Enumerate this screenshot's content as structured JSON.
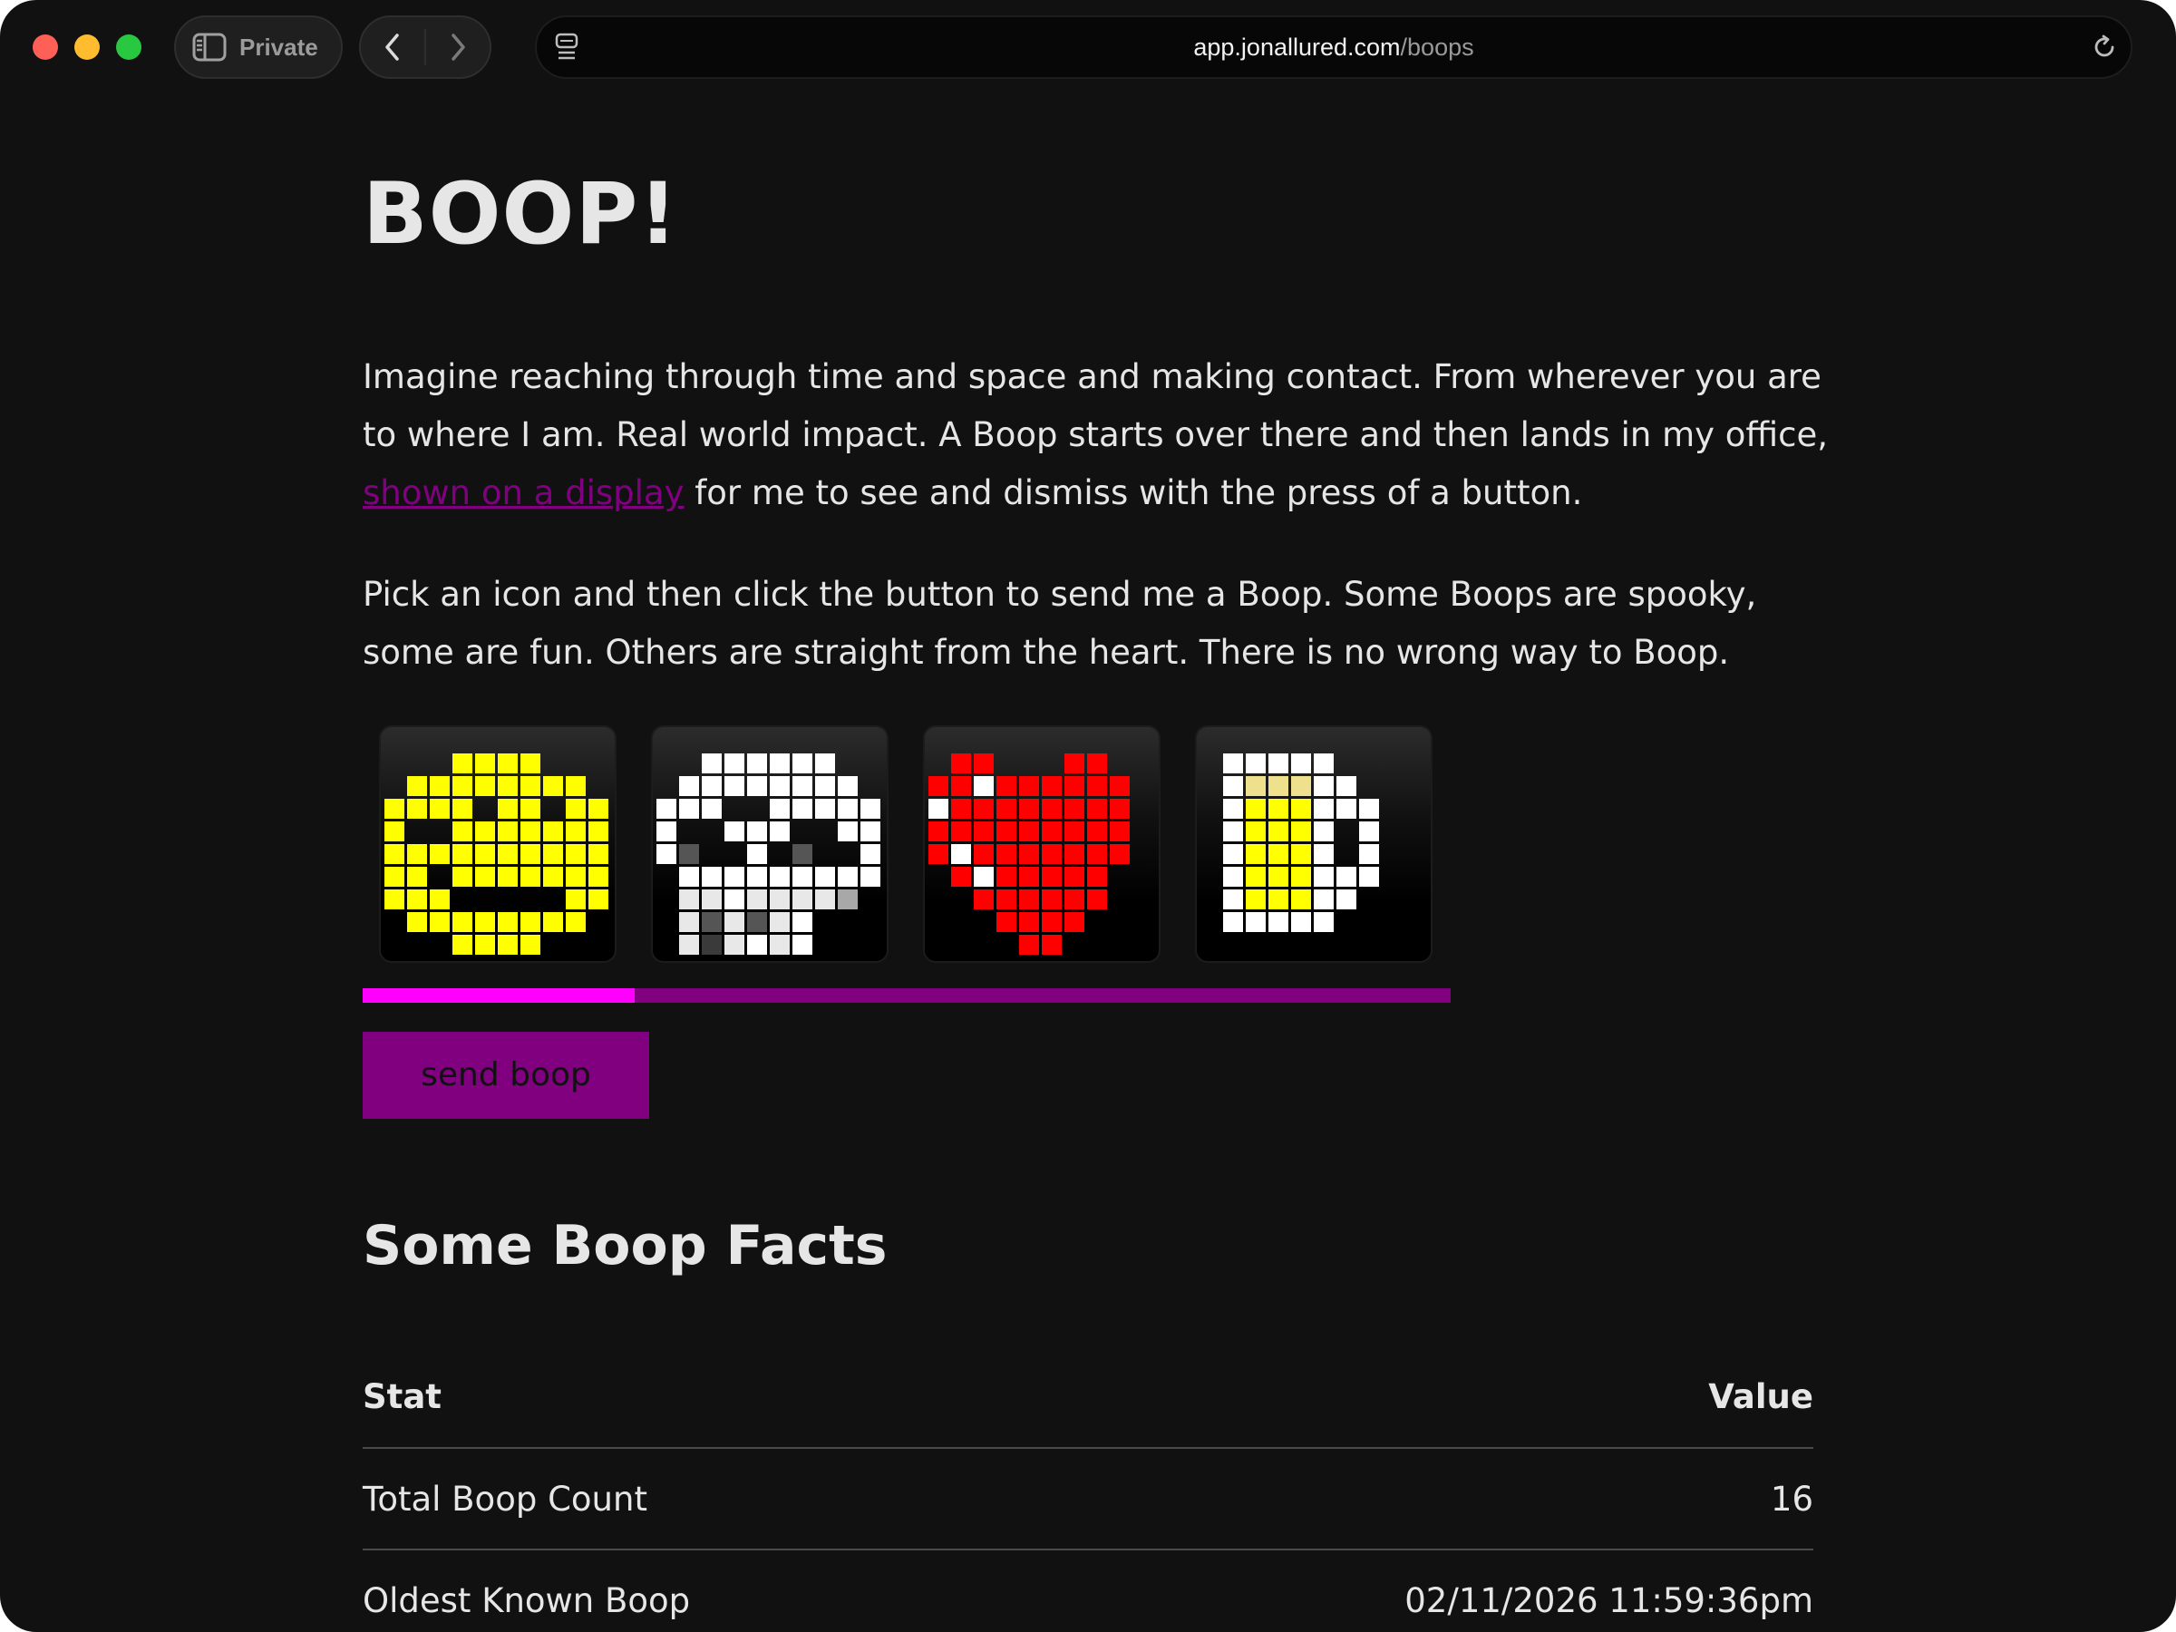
{
  "browser": {
    "private_label": "Private",
    "url_host": "app.jonallured.com",
    "url_path": "/boops"
  },
  "page": {
    "title": "BOOP!",
    "intro_before_link": "Imagine reaching through time and space and making contact. From wherever you are to where I am. Real world impact. A Boop starts over there and then lands in my office, ",
    "intro_link": "shown on a display",
    "intro_after_link": " for me to see and dismiss with the press of a button.",
    "instructions": "Pick an icon and then click the button to send me a Boop. Some Boops are spooky, some are fun. Others are straight from the heart. There is no wrong way to Boop.",
    "icons": [
      {
        "name": "smiley-icon",
        "color": "#ffff00",
        "selected": true
      },
      {
        "name": "skull-icon",
        "color": "#ffffff",
        "selected": false
      },
      {
        "name": "heart-icon",
        "color": "#ff0000",
        "selected": false
      },
      {
        "name": "beer-mug-icon",
        "color": "#ffff00",
        "selected": false
      }
    ],
    "selection_progress": 0.25,
    "send_button": "send boop"
  },
  "facts": {
    "heading": "Some Boop Facts",
    "columns": [
      "Stat",
      "Value"
    ],
    "rows": [
      [
        "Total Boop Count",
        "16"
      ],
      [
        "Oldest Known Boop",
        "02/11/2026 11:59:36pm"
      ]
    ]
  },
  "colors": {
    "accent": "#800080",
    "accent_bright": "#ff00ff",
    "background": "#111111",
    "text": "#e6e6e6"
  }
}
